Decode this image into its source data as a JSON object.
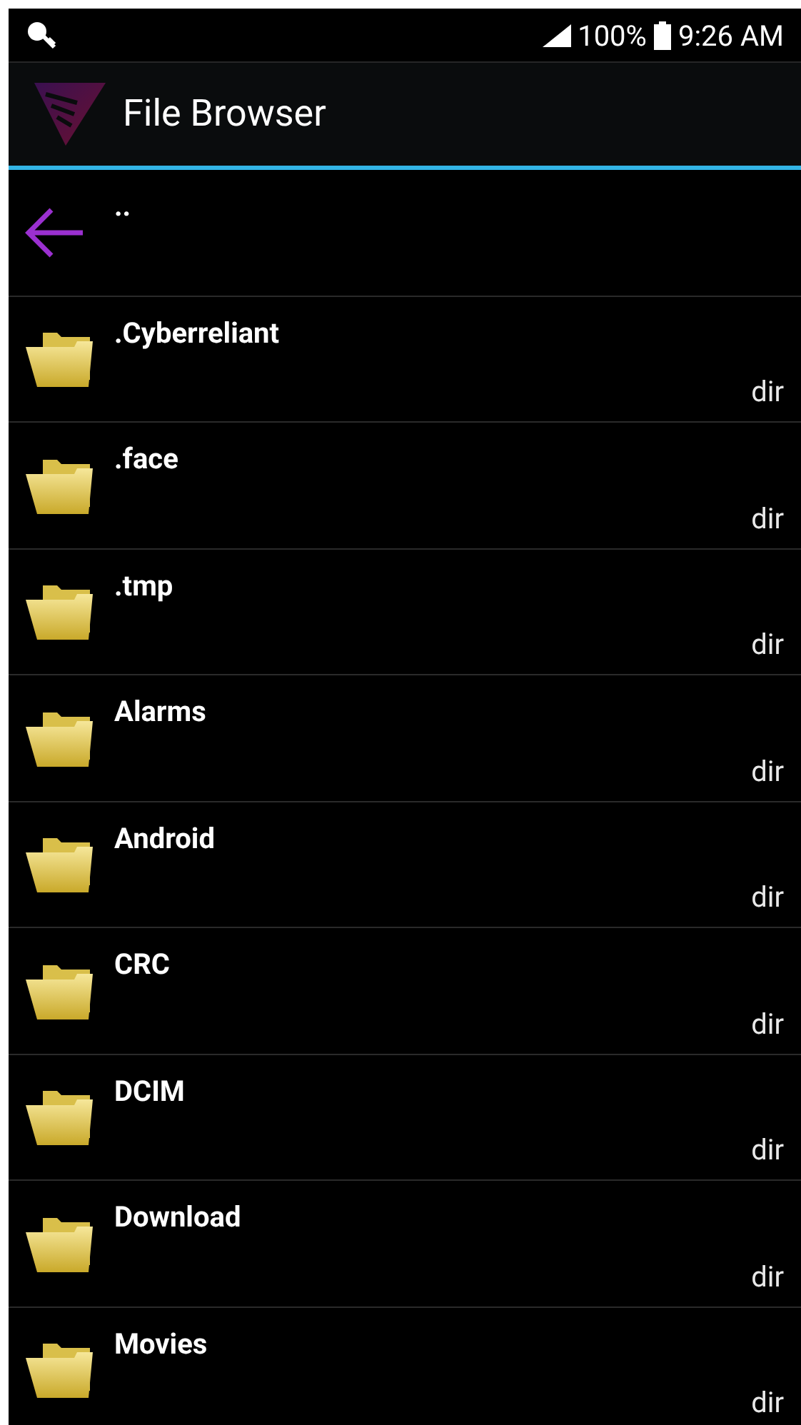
{
  "status_bar": {
    "battery_text": "100%",
    "time": "9:26 AM"
  },
  "app_bar": {
    "title": "File Browser"
  },
  "entries": [
    {
      "kind": "up",
      "name": ".."
    },
    {
      "kind": "folder",
      "name": ".Cyberreliant",
      "type": "dir"
    },
    {
      "kind": "folder",
      "name": ".face",
      "type": "dir"
    },
    {
      "kind": "folder",
      "name": ".tmp",
      "type": "dir"
    },
    {
      "kind": "folder",
      "name": "Alarms",
      "type": "dir"
    },
    {
      "kind": "folder",
      "name": "Android",
      "type": "dir"
    },
    {
      "kind": "folder",
      "name": "CRC",
      "type": "dir"
    },
    {
      "kind": "folder",
      "name": "DCIM",
      "type": "dir"
    },
    {
      "kind": "folder",
      "name": "Download",
      "type": "dir"
    },
    {
      "kind": "folder",
      "name": "Movies",
      "type": "dir"
    }
  ]
}
